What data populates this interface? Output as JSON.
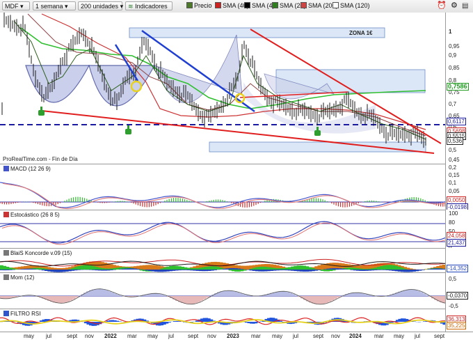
{
  "toolbar": {
    "ticker": "MDF",
    "period": "1 semana",
    "units": "200 unidades",
    "indicators": "Indicadores",
    "legend": [
      {
        "label": "Precio",
        "color": "#4d7a2a",
        "checked": true
      },
      {
        "label": "SMA (40)",
        "color": "#cc2222",
        "checked": true
      },
      {
        "label": "SMA (4)",
        "color": "#000000",
        "checked": false
      },
      {
        "label": "SMA (20)",
        "color": "#2f7d1e",
        "checked": false
      },
      {
        "label": "SMA (200)",
        "color": "#cc4444",
        "checked": true
      },
      {
        "label": "SMA (120)",
        "color": "#ffffff",
        "checked": false
      }
    ]
  },
  "main": {
    "source": "ProRealTime.com - Fin de Día",
    "zone_label": "ZONA 1€",
    "yticks": [
      "1",
      "0,95",
      "0,9",
      "0,85",
      "0,8",
      "0,75",
      "0,7",
      "0,65",
      "0,6",
      "0,55",
      "0,5",
      "0,45"
    ],
    "tags": [
      {
        "text": "0,7586",
        "color": "#1f9a1f"
      },
      {
        "text": "0,6117",
        "color": "#1a1aa0"
      },
      {
        "text": "0,5698",
        "color": "#cc2222"
      },
      {
        "text": "0,5515",
        "color": "#222222"
      },
      {
        "text": "0,536",
        "color": "#222222"
      }
    ]
  },
  "macd": {
    "label": "MACD (12 26 9)",
    "yticks": [
      "0,2",
      "0,15",
      "0,1",
      "0,05",
      "0",
      "-0,05"
    ],
    "tags": [
      "0,0050",
      "-0,0198"
    ]
  },
  "stoch": {
    "label": "Estocástico (26 8 5)",
    "yticks": [
      "100",
      "80",
      "50",
      "20",
      "0"
    ],
    "tags": [
      "24,058",
      "21,437"
    ]
  },
  "koncorde": {
    "label": "BlaiS Koncorde v.09 (15)",
    "tags": [
      "-14,352"
    ]
  },
  "mom": {
    "label": "Mom (12)",
    "yticks": [
      "0,5",
      "0",
      "-0,5"
    ],
    "tags": [
      "-0,0370"
    ]
  },
  "rsi": {
    "label": "FILTRO RSI",
    "tags": [
      "36,313",
      "35,225"
    ]
  },
  "xaxis": [
    {
      "text": "may",
      "bold": false
    },
    {
      "text": "jul",
      "bold": false
    },
    {
      "text": "sept",
      "bold": false
    },
    {
      "text": "nov",
      "bold": false
    },
    {
      "text": "2022",
      "bold": true
    },
    {
      "text": "mar",
      "bold": false
    },
    {
      "text": "may",
      "bold": false
    },
    {
      "text": "jul",
      "bold": false
    },
    {
      "text": "sept",
      "bold": false
    },
    {
      "text": "nov",
      "bold": false
    },
    {
      "text": "2023",
      "bold": true
    },
    {
      "text": "mar",
      "bold": false
    },
    {
      "text": "may",
      "bold": false
    },
    {
      "text": "jul",
      "bold": false
    },
    {
      "text": "sept",
      "bold": false
    },
    {
      "text": "nov",
      "bold": false
    },
    {
      "text": "2024",
      "bold": true
    },
    {
      "text": "mar",
      "bold": false
    },
    {
      "text": "may",
      "bold": false
    },
    {
      "text": "jul",
      "bold": false
    },
    {
      "text": "sept",
      "bold": false
    }
  ]
}
